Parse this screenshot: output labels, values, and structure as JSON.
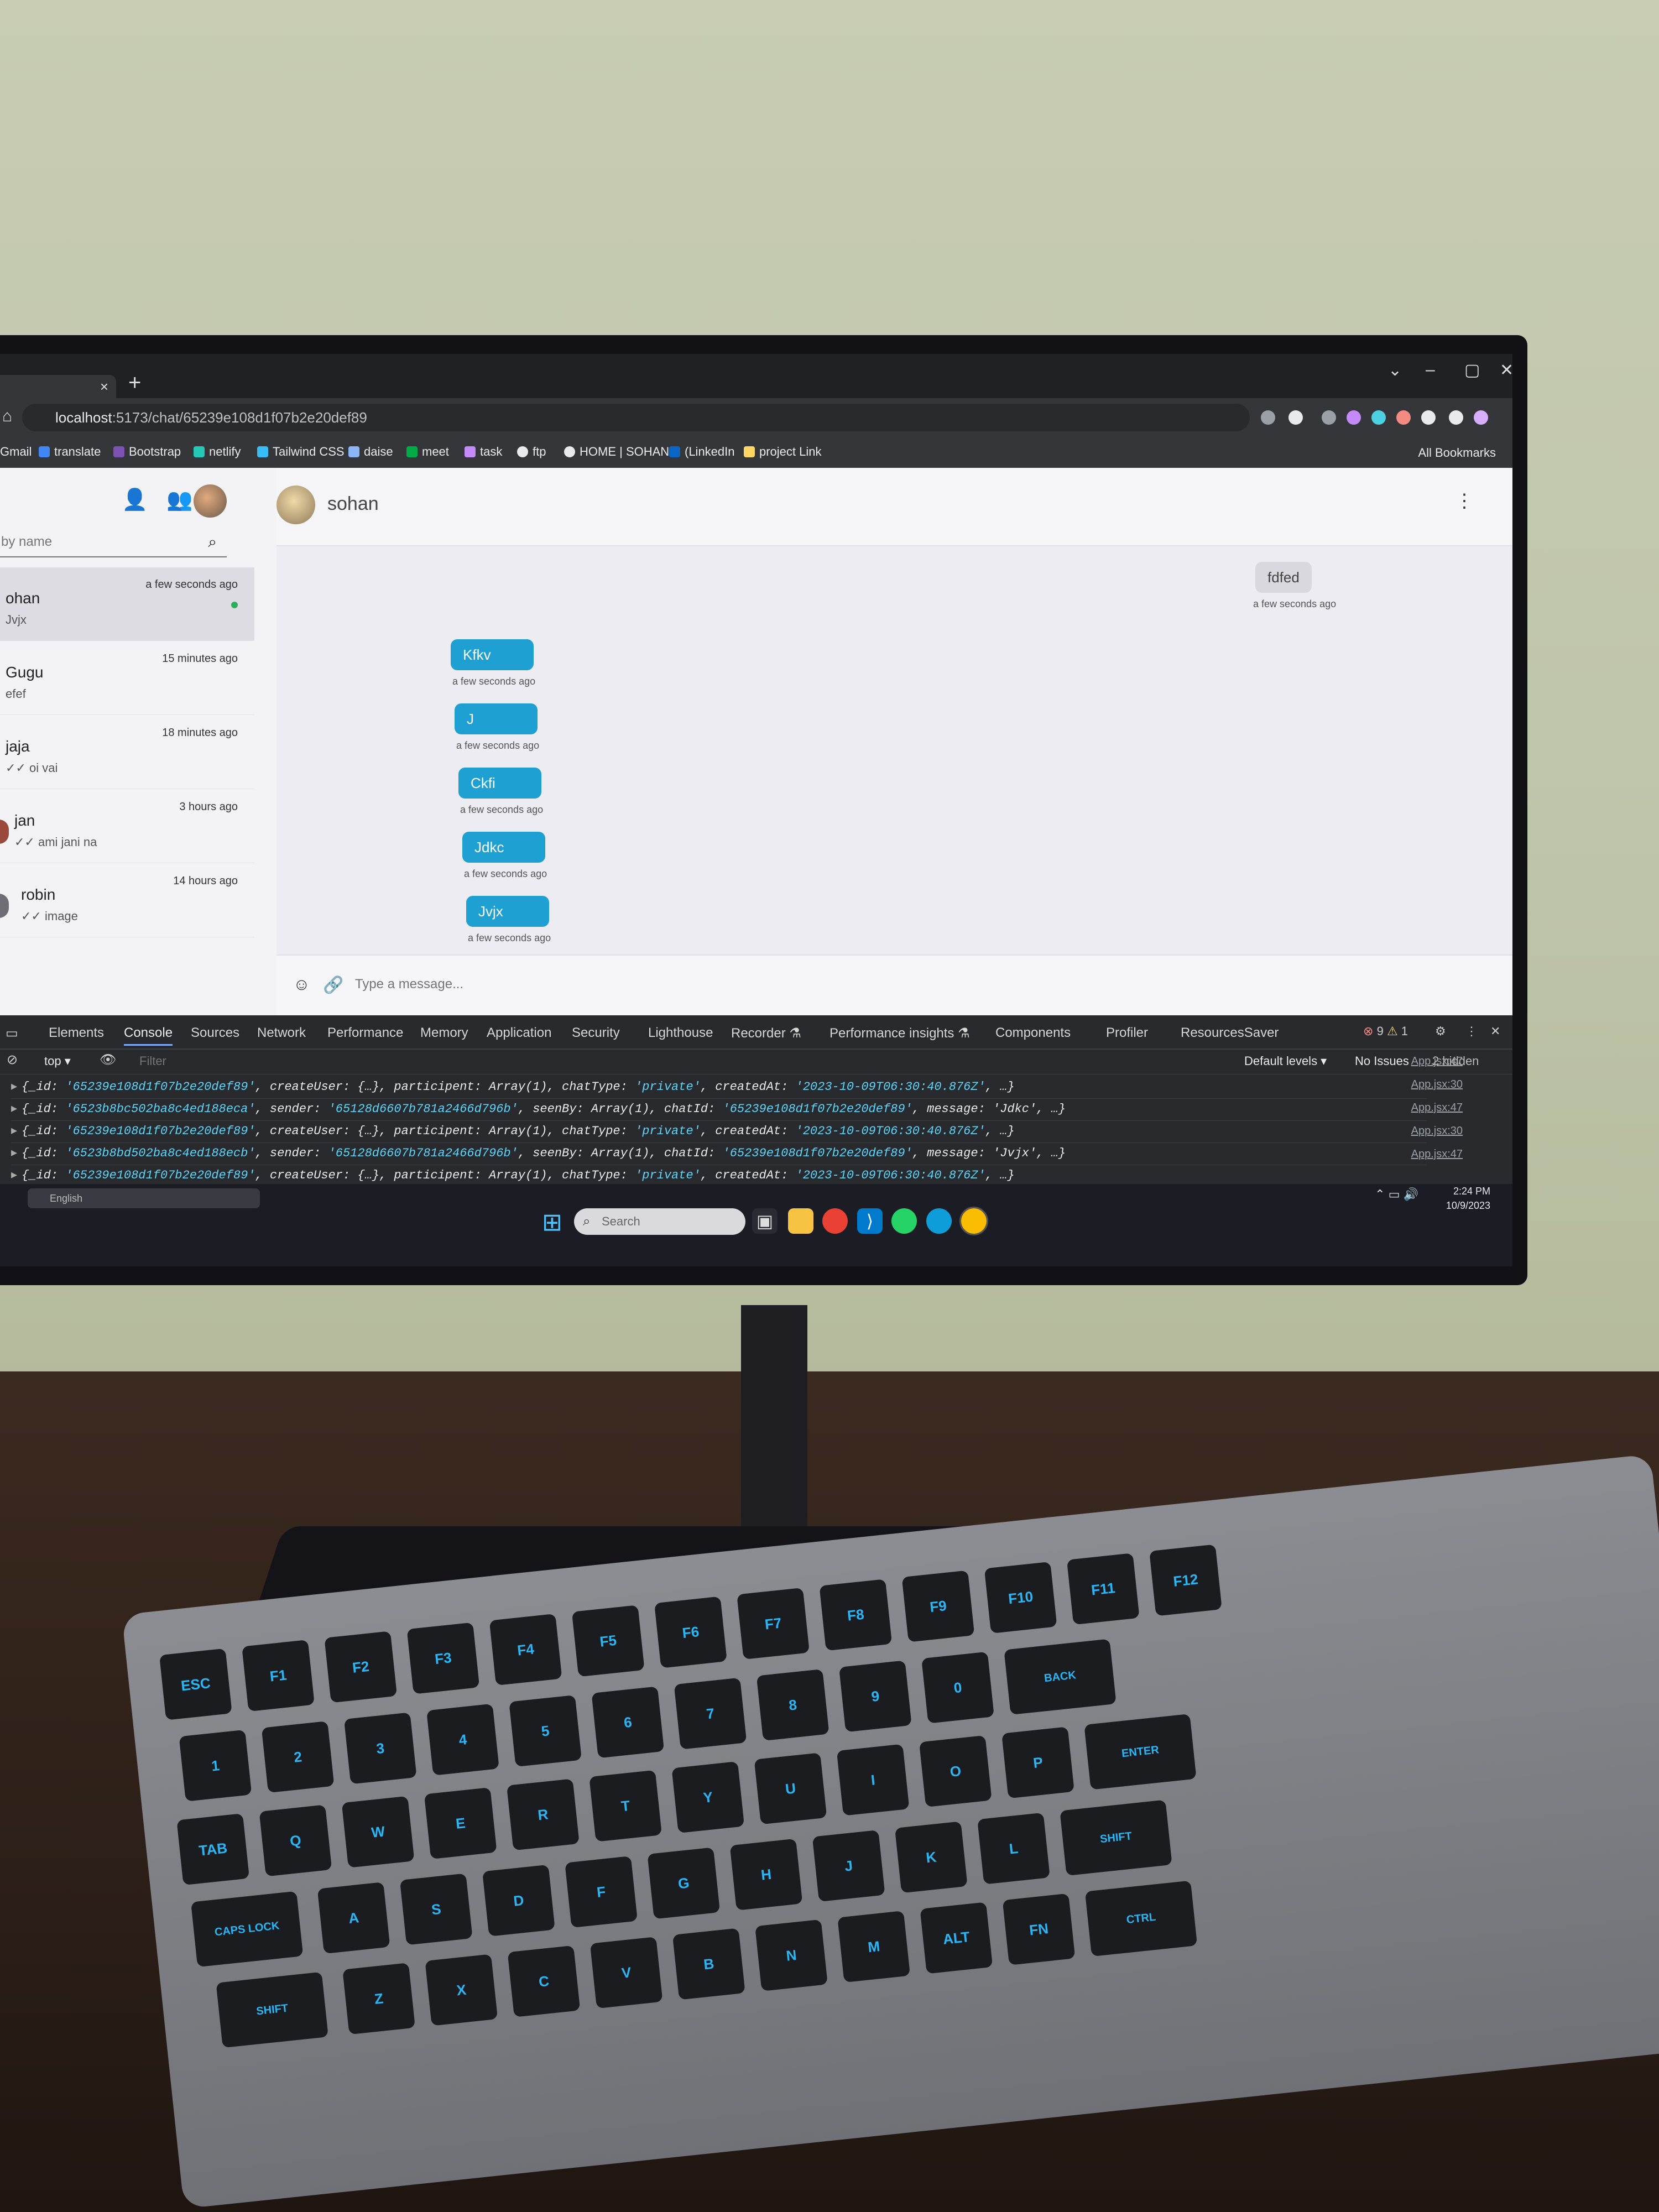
{
  "browser": {
    "url_host": "localhost",
    "url_path": ":5173/chat/65239e108d1f07b2e20def89",
    "new_tab_symbol": "+",
    "tab_close_symbol": "×",
    "window_controls": [
      "⌄",
      "–",
      "▢",
      "✕"
    ],
    "bookmarks": [
      {
        "label": "Gmail",
        "color": "#d93025"
      },
      {
        "label": "translate",
        "color": "#4285f4"
      },
      {
        "label": "Bootstrap",
        "color": "#7952b3"
      },
      {
        "label": "netlify",
        "color": "#25c7b7"
      },
      {
        "label": "Tailwind CSS",
        "color": "#38bdf8"
      },
      {
        "label": "daise",
        "color": "#8ab4f8"
      },
      {
        "label": "meet",
        "color": "#00ac47"
      },
      {
        "label": "task",
        "color": "#c58af9"
      },
      {
        "label": "ftp",
        "color": "#e8eaed"
      },
      {
        "label": "HOME | SOHAN",
        "color": "#e8eaed"
      },
      {
        "label": "(LinkedIn",
        "color": "#0a66c2"
      },
      {
        "label": "project Link",
        "color": "#fdd663"
      }
    ],
    "all_bookmarks": "All Bookmarks"
  },
  "sidebar": {
    "search_placeholder": "by name",
    "conversations": [
      {
        "name": "ohan",
        "last": "Jvjx",
        "time": "a few seconds ago",
        "online": true
      },
      {
        "name": "Gugu",
        "last": "efef",
        "time": "15 minutes ago"
      },
      {
        "name": "jaja",
        "last": "✓✓ oi vai",
        "time": "18 minutes ago"
      },
      {
        "name": "jan",
        "last": "✓✓ ami jani na",
        "time": "3 hours ago"
      },
      {
        "name": "robin",
        "last": "✓✓ image",
        "time": "14 hours ago"
      }
    ]
  },
  "chat": {
    "peer_name": "sohan",
    "incoming": [
      {
        "text": "fdfed",
        "time": "a few seconds ago"
      }
    ],
    "outgoing": [
      {
        "text": "Kfkv",
        "time": "a few seconds ago"
      },
      {
        "text": "J",
        "time": "a few seconds ago"
      },
      {
        "text": "Ckfi",
        "time": "a few seconds ago"
      },
      {
        "text": "Jdkc",
        "time": "a few seconds ago"
      },
      {
        "text": "Jvjx",
        "time": "a few seconds ago"
      }
    ],
    "composer_placeholder": "Type a message..."
  },
  "devtools": {
    "tabs": [
      "Elements",
      "Console",
      "Sources",
      "Network",
      "Performance",
      "Memory",
      "Application",
      "Security",
      "Lighthouse",
      "Recorder ⚗",
      "Performance insights ⚗",
      "Components",
      "Profiler",
      "ResourcesSaver"
    ],
    "active_tab": "Console",
    "error_count": "9",
    "warning_count": "1",
    "context": "top ▾",
    "filter_placeholder": "Filter",
    "levels": "Default levels ▾",
    "issues": "No Issues",
    "hidden": "2 hidden",
    "log_sources": [
      "App.jsx:47",
      "App.jsx:30",
      "App.jsx:47",
      "App.jsx:30",
      "App.jsx:47"
    ],
    "logs": [
      {
        "pre": "{_id: ",
        "id": "'65239e108d1f07b2e20def89'",
        "mid": ", createUser: {…}, participent: Array(1), chatType: ",
        "s2": "'private'",
        "mid2": ", createdAt: ",
        "s3": "'2023-10-09T06:30:40.876Z'",
        "end": ", …}"
      },
      {
        "pre": "{_id: ",
        "id": "'6523b8bc502ba8c4ed188eca'",
        "mid": ", sender: ",
        "s2": "'65128d6607b781a2466d796b'",
        "mid2": ", seenBy: Array(1), chatId: ",
        "s3": "'65239e108d1f07b2e20def89'",
        "end": ", message: 'Jdkc', …}"
      },
      {
        "pre": "{_id: ",
        "id": "'65239e108d1f07b2e20def89'",
        "mid": ", createUser: {…}, participent: Array(1), chatType: ",
        "s2": "'private'",
        "mid2": ", createdAt: ",
        "s3": "'2023-10-09T06:30:40.876Z'",
        "end": ", …}"
      },
      {
        "pre": "{_id: ",
        "id": "'6523b8bd502ba8c4ed188ecb'",
        "mid": ", sender: ",
        "s2": "'65128d6607b781a2466d796b'",
        "mid2": ", seenBy: Array(1), chatId: ",
        "s3": "'65239e108d1f07b2e20def89'",
        "end": ", message: 'Jvjx', …}"
      },
      {
        "pre": "{_id: ",
        "id": "'65239e108d1f07b2e20def89'",
        "mid": ", createUser: {…}, participent: Array(1), chatType: ",
        "s2": "'private'",
        "mid2": ", createdAt: ",
        "s3": "'2023-10-09T06:30:40.876Z'",
        "end": ", …}"
      }
    ]
  },
  "taskbar": {
    "language": "English",
    "search_placeholder": "Search",
    "time": "2:24 PM",
    "date": "10/9/2023"
  },
  "keyboard": {
    "rows": [
      [
        "ESC",
        "F1",
        "F2",
        "F3",
        "F4",
        "F5",
        "F6",
        "F7",
        "F8",
        "F9",
        "F10",
        "F11",
        "F12"
      ],
      [
        "1",
        "2",
        "3",
        "4",
        "5",
        "6",
        "7",
        "8",
        "9",
        "0",
        "BACK"
      ],
      [
        "TAB",
        "Q",
        "W",
        "E",
        "R",
        "T",
        "Y",
        "U",
        "I",
        "O",
        "P",
        "ENTER"
      ],
      [
        "CAPS LOCK",
        "A",
        "S",
        "D",
        "F",
        "G",
        "H",
        "J",
        "K",
        "L",
        "SHIFT"
      ],
      [
        "SHIFT",
        "Z",
        "X",
        "C",
        "V",
        "B",
        "N",
        "M",
        "ALT",
        "FN",
        "CTRL"
      ]
    ]
  }
}
